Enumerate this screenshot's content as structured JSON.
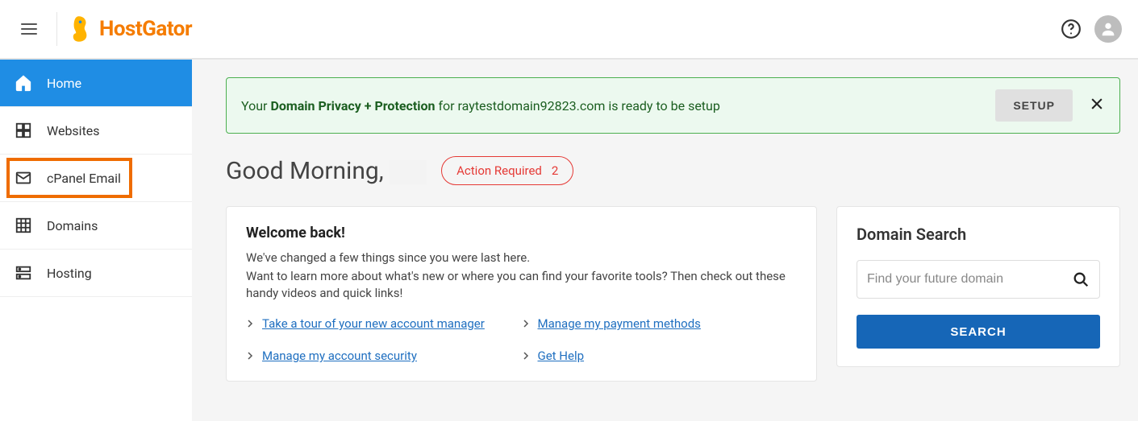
{
  "brand": {
    "name": "HostGator"
  },
  "sidebar": {
    "items": [
      {
        "label": "Home"
      },
      {
        "label": "Websites"
      },
      {
        "label": "cPanel Email"
      },
      {
        "label": "Domains"
      },
      {
        "label": "Hosting"
      }
    ]
  },
  "alert": {
    "prefix": "Your ",
    "bold": "Domain Privacy + Protection",
    "suffix": " for raytestdomain92823.com is ready to be setup",
    "button": "SETUP"
  },
  "greeting": {
    "text": "Good Morning,",
    "action_label": "Action Required",
    "action_count": "2"
  },
  "welcome": {
    "title": "Welcome back!",
    "line1": "We've changed a few things since you were last here.",
    "line2": "Want to learn more about what's new or where you can find your favorite tools? Then check out these handy videos and quick links!",
    "links": [
      "Take a tour of your new account manager",
      "Manage my payment methods",
      "Manage my account security",
      "Get Help"
    ]
  },
  "domain_search": {
    "title": "Domain Search",
    "placeholder": "Find your future domain",
    "button": "SEARCH"
  }
}
